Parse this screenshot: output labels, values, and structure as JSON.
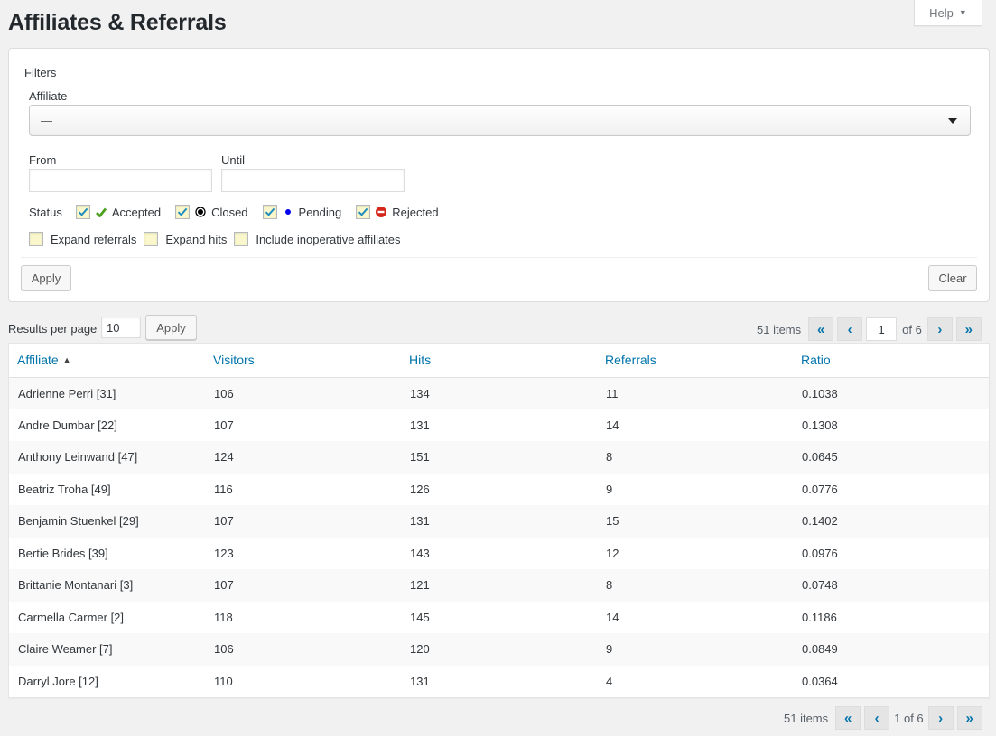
{
  "page": {
    "title": "Affiliates & Referrals",
    "help_label": "Help"
  },
  "filters": {
    "title": "Filters",
    "affiliate_label": "Affiliate",
    "affiliate_value": "—",
    "from_label": "From",
    "from_value": "",
    "until_label": "Until",
    "until_value": "",
    "status_label": "Status",
    "statuses": [
      {
        "label": "Accepted",
        "checked": true,
        "icon": "check-icon",
        "color": "#4ca01e"
      },
      {
        "label": "Closed",
        "checked": true,
        "icon": "radio-dot-icon",
        "color": "#000000"
      },
      {
        "label": "Pending",
        "checked": true,
        "icon": "dot-icon",
        "color": "#0000ee"
      },
      {
        "label": "Rejected",
        "checked": true,
        "icon": "no-entry-icon",
        "color": "#d5261a"
      }
    ],
    "options": [
      {
        "label": "Expand referrals",
        "checked": false
      },
      {
        "label": "Expand hits",
        "checked": false
      },
      {
        "label": "Include inoperative affiliates",
        "checked": false
      }
    ],
    "apply_label": "Apply",
    "clear_label": "Clear"
  },
  "results": {
    "per_page_label": "Results per page",
    "per_page_value": "10",
    "apply_label": "Apply"
  },
  "pagination_top": {
    "count": "51 items",
    "first": "«",
    "prev": "‹",
    "current_page": "1",
    "of_text": "of 6",
    "next": "›",
    "last": "»"
  },
  "pagination_bottom": {
    "count": "51 items",
    "first": "«",
    "prev": "‹",
    "page_text": "1 of 6",
    "next": "›",
    "last": "»"
  },
  "table": {
    "columns": [
      "Affiliate",
      "Visitors",
      "Hits",
      "Referrals",
      "Ratio"
    ],
    "sort_indicator": "▲",
    "rows": [
      [
        "Adrienne Perri [31]",
        "106",
        "134",
        "11",
        "0.1038"
      ],
      [
        "Andre Dumbar [22]",
        "107",
        "131",
        "14",
        "0.1308"
      ],
      [
        "Anthony Leinwand [47]",
        "124",
        "151",
        "8",
        "0.0645"
      ],
      [
        "Beatriz Troha [49]",
        "116",
        "126",
        "9",
        "0.0776"
      ],
      [
        "Benjamin Stuenkel [29]",
        "107",
        "131",
        "15",
        "0.1402"
      ],
      [
        "Bertie Brides [39]",
        "123",
        "143",
        "12",
        "0.0976"
      ],
      [
        "Brittanie Montanari [3]",
        "107",
        "121",
        "8",
        "0.0748"
      ],
      [
        "Carmella Carmer [2]",
        "118",
        "145",
        "14",
        "0.1186"
      ],
      [
        "Claire Weamer [7]",
        "106",
        "120",
        "9",
        "0.0849"
      ],
      [
        "Darryl Jore [12]",
        "110",
        "131",
        "4",
        "0.0364"
      ]
    ]
  }
}
